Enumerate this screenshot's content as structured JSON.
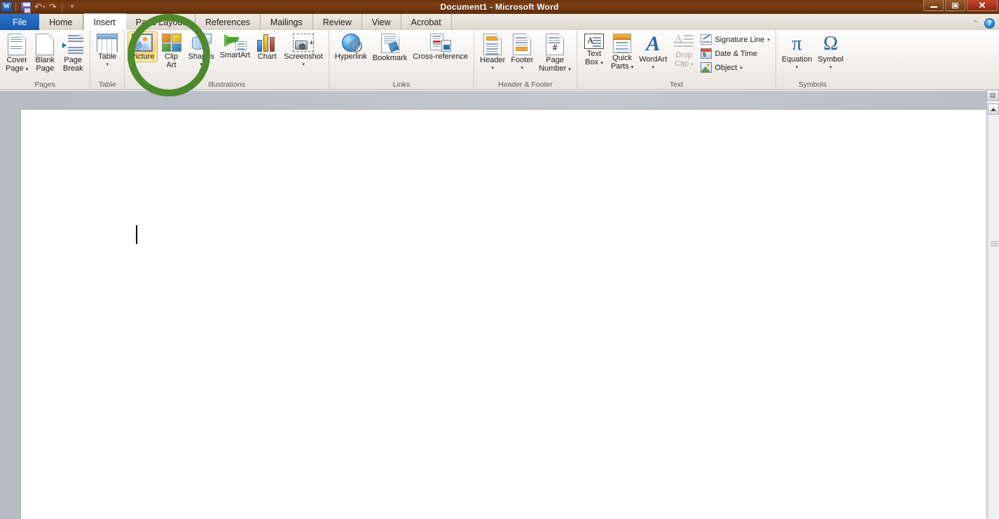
{
  "window": {
    "title": "Document1  -  Microsoft Word",
    "logo": "word-logo",
    "logo_text": "W",
    "controls": {
      "minimize": "minimize",
      "restore": "restore",
      "close": "✕"
    }
  },
  "quick_access": {
    "items": [
      {
        "name": "save",
        "icon": "save-icon",
        "label": "Save"
      },
      {
        "name": "undo",
        "icon": "undo-icon",
        "label": "↶",
        "has_dropdown": true
      },
      {
        "name": "redo",
        "icon": "redo-icon",
        "label": "↷",
        "has_dropdown": false
      },
      {
        "name": "customize",
        "icon": "customize-qat-icon",
        "label": "▾",
        "has_dropdown": false
      }
    ]
  },
  "tabs": [
    {
      "label": "File",
      "state": "file"
    },
    {
      "label": "Home",
      "state": "normal"
    },
    {
      "label": "Insert",
      "state": "active"
    },
    {
      "label": "Page Layout",
      "state": "normal"
    },
    {
      "label": "References",
      "state": "normal"
    },
    {
      "label": "Mailings",
      "state": "normal"
    },
    {
      "label": "Review",
      "state": "normal"
    },
    {
      "label": "View",
      "state": "normal"
    },
    {
      "label": "Acrobat",
      "state": "normal"
    }
  ],
  "ribbon": {
    "collapse_label": "⌃",
    "help_label": "?",
    "groups": [
      {
        "name": "pages",
        "label": "Pages",
        "buttons": [
          {
            "name": "cover-page",
            "label": "Cover\nPage",
            "line1": "Cover",
            "line2": "Page",
            "caret": "▾",
            "icon": "cover-page-icon",
            "disabled": false
          },
          {
            "name": "blank-page",
            "label": "Blank Page",
            "line1": "Blank",
            "line2": "Page",
            "caret": "",
            "icon": "blank-page-icon",
            "disabled": false
          },
          {
            "name": "page-break",
            "label": "Page Break",
            "line1": "Page",
            "line2": "Break",
            "caret": "",
            "icon": "page-break-icon",
            "disabled": false
          }
        ]
      },
      {
        "name": "tables",
        "label": "Table",
        "buttons": [
          {
            "name": "table",
            "label": "Table",
            "line1": "Table",
            "line2": "",
            "caret": "▾",
            "icon": "table-icon",
            "disabled": false
          }
        ]
      },
      {
        "name": "illustrations",
        "label": "Illustrations",
        "buttons": [
          {
            "name": "picture",
            "label": "Picture",
            "line1": "Picture",
            "line2": "",
            "caret": "",
            "icon": "picture-icon",
            "highlighted": true
          },
          {
            "name": "clip-art",
            "label": "Clip Art",
            "line1": "Clip",
            "line2": "Art",
            "caret": "",
            "icon": "clip-art-icon",
            "disabled": false
          },
          {
            "name": "shapes",
            "label": "Shapes",
            "line1": "Shapes",
            "line2": "",
            "caret": "▾",
            "icon": "shapes-icon",
            "disabled": false
          },
          {
            "name": "smartart",
            "label": "SmartArt",
            "line1": "SmartArt",
            "line2": "",
            "caret": "",
            "icon": "smartart-icon",
            "disabled": false
          },
          {
            "name": "chart",
            "label": "Chart",
            "line1": "Chart",
            "line2": "",
            "caret": "",
            "icon": "chart-icon",
            "disabled": false
          },
          {
            "name": "screenshot",
            "label": "Screenshot",
            "line1": "Screenshot",
            "line2": "",
            "caret": "▾",
            "icon": "screenshot-icon",
            "disabled": false
          }
        ]
      },
      {
        "name": "links",
        "label": "Links",
        "buttons": [
          {
            "name": "hyperlink",
            "label": "Hyperlink",
            "line1": "Hyperlink",
            "line2": "",
            "caret": "",
            "icon": "hyperlink-icon",
            "disabled": false
          },
          {
            "name": "bookmark",
            "label": "Bookmark",
            "line1": "Bookmark",
            "line2": "",
            "caret": "",
            "icon": "bookmark-icon",
            "disabled": false
          },
          {
            "name": "cross-reference",
            "label": "Cross-reference",
            "line1": "Cross-reference",
            "line2": "",
            "caret": "",
            "icon": "cross-reference-icon",
            "disabled": false
          }
        ]
      },
      {
        "name": "header-footer",
        "label": "Header & Footer",
        "buttons": [
          {
            "name": "header",
            "label": "Header",
            "line1": "Header",
            "line2": "",
            "caret": "▾",
            "icon": "header-icon",
            "disabled": false
          },
          {
            "name": "footer",
            "label": "Footer",
            "line1": "Footer",
            "line2": "",
            "caret": "▾",
            "icon": "footer-icon",
            "disabled": false
          },
          {
            "name": "page-number",
            "label": "Page Number",
            "line1": "Page",
            "line2": "Number",
            "caret": "▾",
            "icon": "page-number-icon",
            "disabled": false
          }
        ]
      },
      {
        "name": "text",
        "label": "Text",
        "buttons": [
          {
            "name": "text-box",
            "label": "Text Box",
            "line1": "Text",
            "line2": "Box",
            "caret": "▾",
            "icon": "text-box-icon",
            "disabled": false
          },
          {
            "name": "quick-parts",
            "label": "Quick Parts",
            "line1": "Quick",
            "line2": "Parts",
            "caret": "▾",
            "icon": "quick-parts-icon",
            "disabled": false
          },
          {
            "name": "wordart",
            "label": "WordArt",
            "line1": "WordArt",
            "line2": "",
            "caret": "▾",
            "icon": "wordart-icon",
            "disabled": false
          },
          {
            "name": "drop-cap",
            "label": "Drop Cap",
            "line1": "Drop",
            "line2": "Cap",
            "caret": "▾",
            "icon": "drop-cap-icon",
            "disabled": true
          }
        ],
        "small_buttons": [
          {
            "name": "signature-line",
            "label": "Signature Line",
            "caret": "▾",
            "icon": "signature-line-icon"
          },
          {
            "name": "date-and-time",
            "label": "Date & Time",
            "caret": "",
            "icon": "date-time-icon"
          },
          {
            "name": "object",
            "label": "Object",
            "caret": "▾",
            "icon": "object-icon"
          }
        ]
      },
      {
        "name": "symbols",
        "label": "Symbols",
        "buttons": [
          {
            "name": "equation",
            "label": "Equation",
            "line1": "Equation",
            "line2": "",
            "caret": "▾",
            "icon": "equation-icon",
            "glyph": "π",
            "disabled": false
          },
          {
            "name": "symbol",
            "label": "Symbol",
            "line1": "Symbol",
            "line2": "",
            "caret": "▾",
            "icon": "symbol-icon",
            "glyph": "Ω",
            "disabled": false
          }
        ]
      }
    ]
  },
  "document": {
    "name": "Document1",
    "body_text": "",
    "caret_visible": true
  },
  "scrollbar": {
    "ruler_toggle": "▤",
    "scroll_up": "▲"
  },
  "annotation": {
    "type": "circle-highlight",
    "target": "picture-button",
    "color": "#4e8a2d"
  },
  "colors": {
    "titlebar": "#7d4015",
    "file_tab": "#2b72c9",
    "highlight": "#ffd45f",
    "annotation_green": "#4e8a2d",
    "close_red": "#c7462c"
  }
}
